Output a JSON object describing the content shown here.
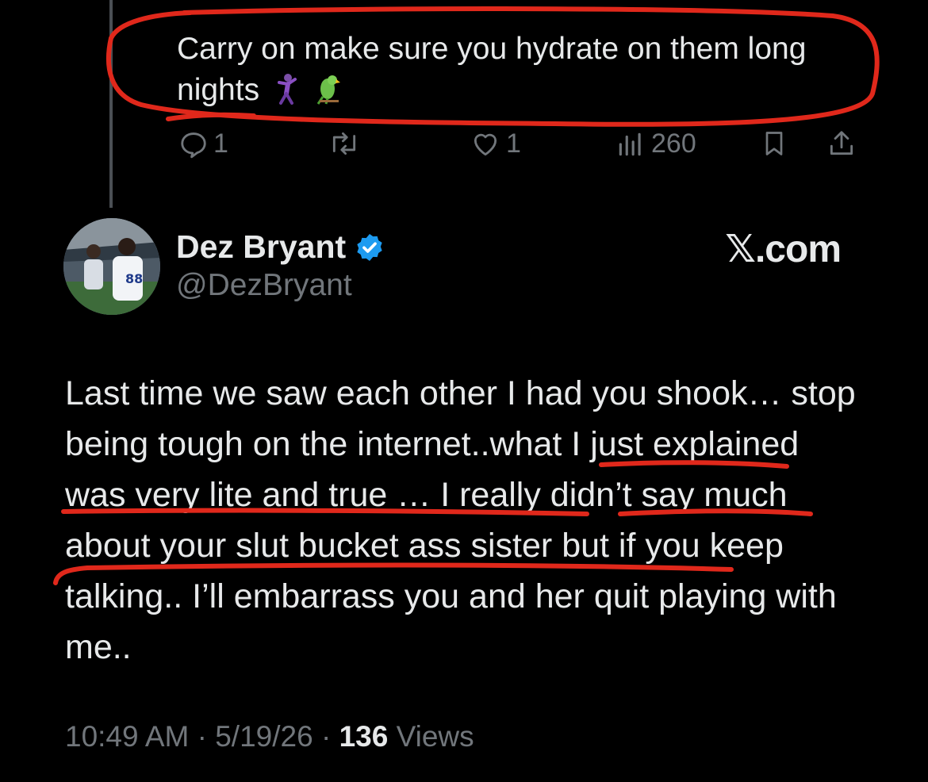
{
  "reply": {
    "text": "Carry on make sure you hydrate on them long nights",
    "emojis": [
      "dancing-man-emoji",
      "parrot-emoji"
    ],
    "actions": {
      "replies": "1",
      "reposts": "",
      "likes": "1",
      "views": "260"
    }
  },
  "tweet": {
    "author_name": "Dez Bryant",
    "author_handle": "@DezBryant",
    "verified": true,
    "watermark": "𝕏.com",
    "body": "Last time we saw each other I had you shook… stop being tough on the internet..what I just explained was very lite and true … I really didn’t say much about your slut bucket ass sister but if you keep talking.. I’ll embarrass you and her quit playing with me..",
    "time": "10:49 AM",
    "date": "5/19/26",
    "views_count": "136",
    "views_label": "Views"
  },
  "colors": {
    "background": "#000000",
    "text": "#e7e9ea",
    "muted": "#71767b",
    "verified_blue": "#1d9bf0",
    "annotation_red": "#e0281b"
  }
}
